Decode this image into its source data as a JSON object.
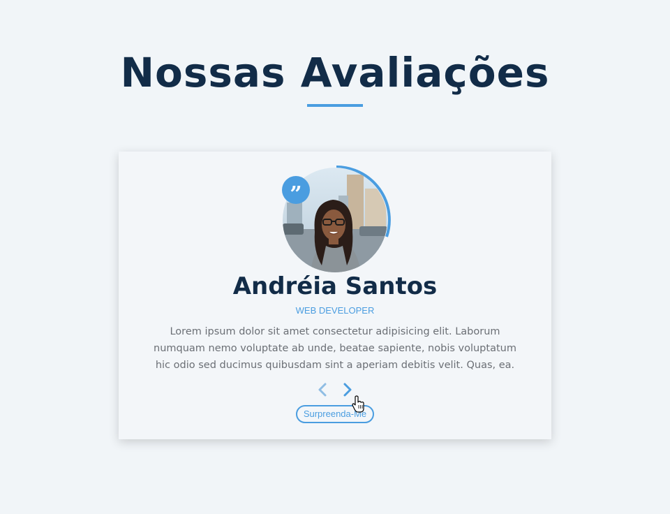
{
  "page": {
    "title": "Nossas Avaliações"
  },
  "testimonial": {
    "name": "Andréia Santos",
    "role": "WEB DEVELOPER",
    "text": "Lorem ipsum dolor sit amet consectetur adipisicing elit. Laborum numquam nemo voluptate ab unde, beatae sapiente, nobis voluptatum hic odio sed ducimus quibusdam sint a aperiam debitis velit. Quas, ea.",
    "quote_glyph": "”",
    "avatar_icon": "person-photo",
    "quote_icon": "quote-icon"
  },
  "controls": {
    "prev_icon": "chevron-left-icon",
    "next_icon": "chevron-right-icon",
    "surprise_label": "Surpreenda-Me"
  },
  "colors": {
    "accent": "#4a9de0",
    "heading": "#122c48",
    "text": "#6b6f75",
    "background": "#f1f5f8"
  }
}
